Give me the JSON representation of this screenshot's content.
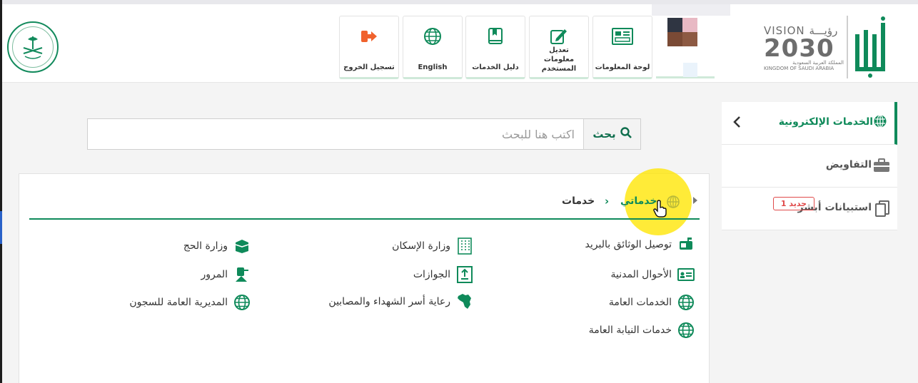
{
  "header": {
    "tiles": [
      {
        "key": "logout",
        "label": "تسجيل الخروج"
      },
      {
        "key": "english",
        "label": "English"
      },
      {
        "key": "guide",
        "label": "دليل الخدمات"
      },
      {
        "key": "edit_user",
        "label": "تعديل معلومات المستخدم"
      },
      {
        "key": "dashboard",
        "label": "لوحة المعلومات"
      }
    ],
    "vision": {
      "line1": "VISION رؤيـــة",
      "line2": "2030",
      "line3": "المملكة العربية السعودية",
      "line4": "KINGDOM OF SAUDI ARABIA"
    }
  },
  "sidebar": {
    "head": "الخدمات الإلكترونية",
    "items": [
      {
        "label": "التفاويض"
      },
      {
        "label": "استبيانات أبشر",
        "badge": "جديد 1"
      }
    ]
  },
  "search": {
    "button": "بحث",
    "placeholder": "اكتب هنا للبحث"
  },
  "breadcrumb": {
    "current": "خدماتي",
    "next": "خدمات"
  },
  "services": {
    "col1": [
      {
        "label": "توصيل الوثائق بالبريد",
        "icon": "mailbox-icon"
      },
      {
        "label": "الأحوال المدنية",
        "icon": "id-card-icon"
      },
      {
        "label": "الخدمات العامة",
        "icon": "globe-icon"
      },
      {
        "label": "خدمات النيابة العامة",
        "icon": "globe-icon"
      }
    ],
    "col2": [
      {
        "label": "وزارة الإسكان",
        "icon": "building-icon"
      },
      {
        "label": "الجوازات",
        "icon": "passport-icon"
      },
      {
        "label": "رعاية أسر الشهداء والمصابين",
        "icon": "map-icon"
      }
    ],
    "col3": [
      {
        "label": "وزارة الحج",
        "icon": "kaaba-icon"
      },
      {
        "label": "المرور",
        "icon": "traffic-icon"
      },
      {
        "label": "المديرية العامة للسجون",
        "icon": "globe-icon"
      }
    ]
  },
  "colors": {
    "brand": "#0f8a5a",
    "logout": "#f0622d",
    "badge": "#e04b4b",
    "highlight": "#ffe600"
  }
}
